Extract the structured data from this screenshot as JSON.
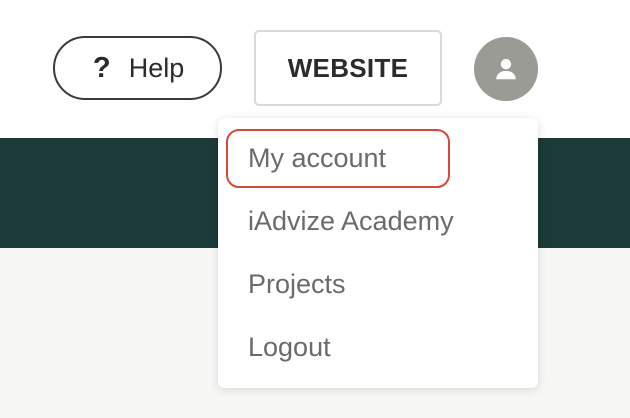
{
  "header": {
    "help_icon": "?",
    "help_label": "Help",
    "website_label": "WEBSITE",
    "avatar_icon": "user-icon"
  },
  "menu": {
    "items": [
      {
        "label": "My account",
        "highlighted": true
      },
      {
        "label": "iAdvize Academy"
      },
      {
        "label": "Projects"
      },
      {
        "label": "Logout"
      }
    ]
  },
  "colors": {
    "band": "#1c3a37",
    "background": "#f7f7f5",
    "avatar": "#9b9b96",
    "highlight": "#d9473a",
    "menu_text": "#6b6b6b"
  }
}
